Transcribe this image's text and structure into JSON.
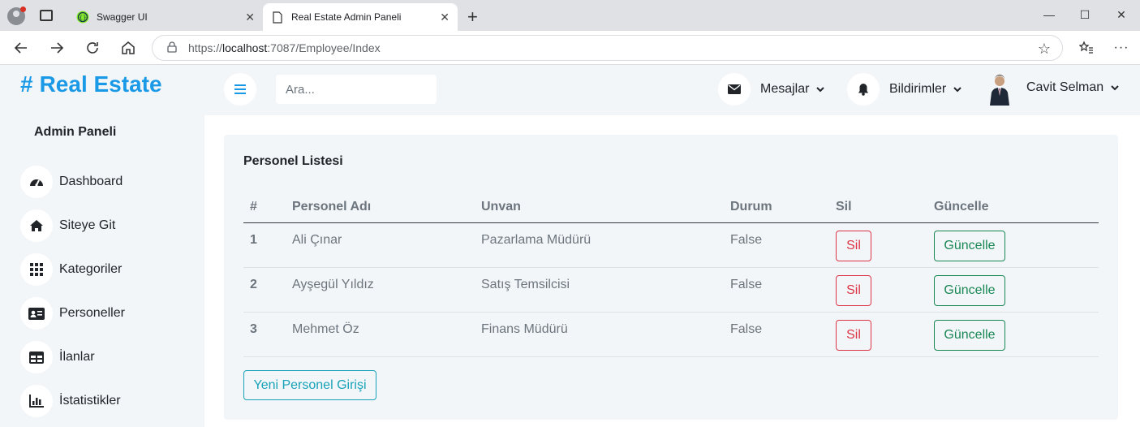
{
  "browser": {
    "tabs": [
      {
        "title": "Swagger UI",
        "icon": "swagger-icon"
      },
      {
        "title": "Real Estate Admin Paneli",
        "icon": "page-icon"
      }
    ],
    "url_prefix": "https://",
    "url_host": "localhost",
    "url_rest": ":7087/Employee/Index"
  },
  "sidebar": {
    "brand_hash": "#",
    "brand": "Real Estate",
    "admin_title": "Admin Paneli",
    "items": [
      {
        "label": "Dashboard",
        "icon": "tachometer-icon"
      },
      {
        "label": "Siteye Git",
        "icon": "home-icon"
      },
      {
        "label": "Kategoriler",
        "icon": "grid-icon"
      },
      {
        "label": "Personeller",
        "icon": "id-card-icon"
      },
      {
        "label": "İlanlar",
        "icon": "table-icon"
      },
      {
        "label": "İstatistikler",
        "icon": "chart-icon"
      }
    ]
  },
  "topbar": {
    "search_placeholder": "Ara...",
    "messages": "Mesajlar",
    "notifications": "Bildirimler",
    "user": "Cavit Selman"
  },
  "card": {
    "title": "Personel Listesi",
    "columns": [
      "#",
      "Personel Adı",
      "Unvan",
      "Durum",
      "Sil",
      "Güncelle"
    ],
    "rows": [
      {
        "no": "1",
        "name": "Ali Çınar",
        "title": "Pazarlama Müdürü",
        "status": "False",
        "delete": "Sil",
        "update": "Güncelle"
      },
      {
        "no": "2",
        "name": "Ayşegül Yıldız",
        "title": "Satış Temsilcisi",
        "status": "False",
        "delete": "Sil",
        "update": "Güncelle"
      },
      {
        "no": "3",
        "name": "Mehmet Öz",
        "title": "Finans Müdürü",
        "status": "False",
        "delete": "Sil",
        "update": "Güncelle"
      }
    ],
    "new_button": "Yeni Personel Girişi"
  },
  "colors": {
    "accent": "#1a9ae6",
    "danger": "#dc3545",
    "success": "#198754",
    "info": "#17a2b8"
  }
}
